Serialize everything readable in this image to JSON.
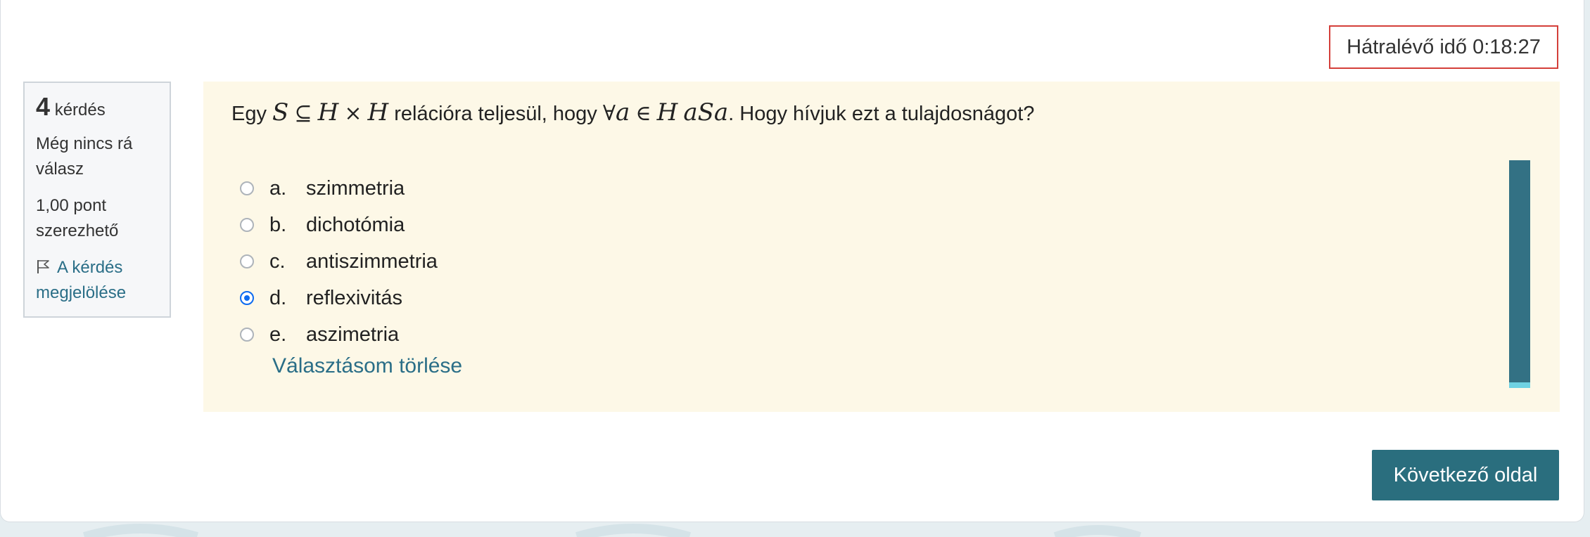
{
  "timer": {
    "label": "Hátralévő idő 0:18:27"
  },
  "info": {
    "number": "4",
    "question_word": "kérdés",
    "status": "Még nincs rá válasz",
    "points": "1,00 pont szerezhető",
    "flag_label": "A kérdés megjelölése"
  },
  "question": {
    "prefix": "Egy",
    "rel_text": "relációra teljesül, hogy",
    "suffix": ". Hogy hívjuk ezt a tulajdosnágot?",
    "math_S": "S",
    "math_subset": "⊆",
    "math_H1": "H",
    "math_times": "×",
    "math_H2": "H",
    "math_forall": "∀",
    "math_a": "a",
    "math_in": "∈",
    "math_H3": "H",
    "math_aSa": "aSa"
  },
  "answers": [
    {
      "letter": "a.",
      "text": "szimmetria",
      "checked": false
    },
    {
      "letter": "b.",
      "text": "dichotómia",
      "checked": false
    },
    {
      "letter": "c.",
      "text": "antiszimmetria",
      "checked": false
    },
    {
      "letter": "d.",
      "text": "reflexivitás",
      "checked": true
    },
    {
      "letter": "e.",
      "text": "aszimetria",
      "checked": false
    }
  ],
  "clear_choice": "Választásom törlése",
  "next_button": "Következő oldal",
  "colors": {
    "accent": "#2a6e7e",
    "timer_border": "#d43f3a",
    "question_bg": "#fdf8e7",
    "radio_checked": "#0f6cf0"
  }
}
